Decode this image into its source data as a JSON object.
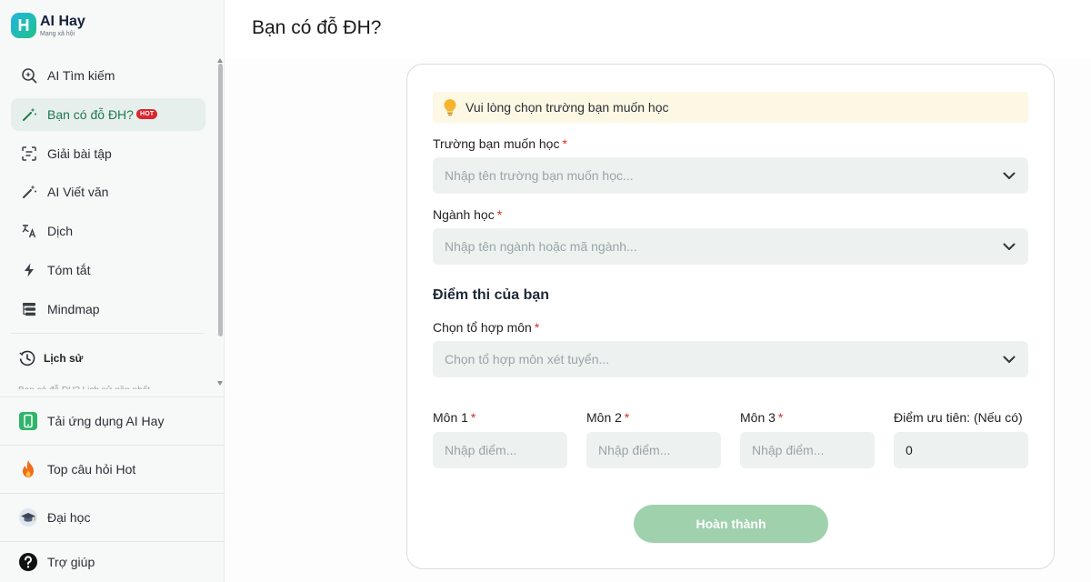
{
  "app": {
    "name": "AI Hay",
    "tagline": "Mạng xã hội"
  },
  "sidebar": {
    "items": [
      {
        "label": "AI Tìm kiếm",
        "icon": "search-sparkle-icon"
      },
      {
        "label": "Bạn có đỗ ĐH?",
        "icon": "magic-wand-icon",
        "badge": "HOT",
        "active": true
      },
      {
        "label": "Giải bài tập",
        "icon": "scan-text-icon"
      },
      {
        "label": "AI Viết văn",
        "icon": "magic-wand-icon"
      },
      {
        "label": "Dịch",
        "icon": "translate-icon"
      },
      {
        "label": "Tóm tắt",
        "icon": "lightning-icon"
      },
      {
        "label": "Mindmap",
        "icon": "mindmap-icon"
      }
    ],
    "history_label": "Lịch sử",
    "history_preview": "Bạn có đỗ ĐH? Lịch sử gần nhất",
    "bottom": [
      {
        "label": "Tải ứng dụng AI Hay",
        "icon": "phone-icon"
      },
      {
        "label": "Top câu hỏi Hot",
        "icon": "fire-icon"
      },
      {
        "label": "Đại học",
        "icon": "graduation-cap-icon"
      },
      {
        "label": "Trợ giúp",
        "icon": "help-icon"
      }
    ]
  },
  "page": {
    "title": "Bạn có đỗ ĐH?"
  },
  "form": {
    "notice": "Vui lòng chọn trường bạn muốn học",
    "school": {
      "label": "Trường bạn muốn học",
      "placeholder": "Nhập tên trường bạn muốn học..."
    },
    "major": {
      "label": "Ngành học",
      "placeholder": "Nhập tên ngành hoặc mã ngành..."
    },
    "section_title": "Điểm thi của bạn",
    "combo": {
      "label": "Chọn tổ hợp môn",
      "placeholder": "Chọn tổ hợp môn xét tuyển..."
    },
    "subjects": [
      {
        "label": "Môn 1",
        "placeholder": "Nhập điểm..."
      },
      {
        "label": "Môn 2",
        "placeholder": "Nhập điểm..."
      },
      {
        "label": "Môn 3",
        "placeholder": "Nhập điểm..."
      }
    ],
    "priority": {
      "label": "Điểm ưu tiên: (Nếu có)",
      "value": "0"
    },
    "required_mark": "*",
    "submit_label": "Hoàn thành"
  },
  "colors": {
    "accent": "#22c08a",
    "active_text": "#1d7a4f",
    "button": "#9fd1ad",
    "hot": "#d9262f",
    "notice_bg": "#fdf8e4"
  }
}
